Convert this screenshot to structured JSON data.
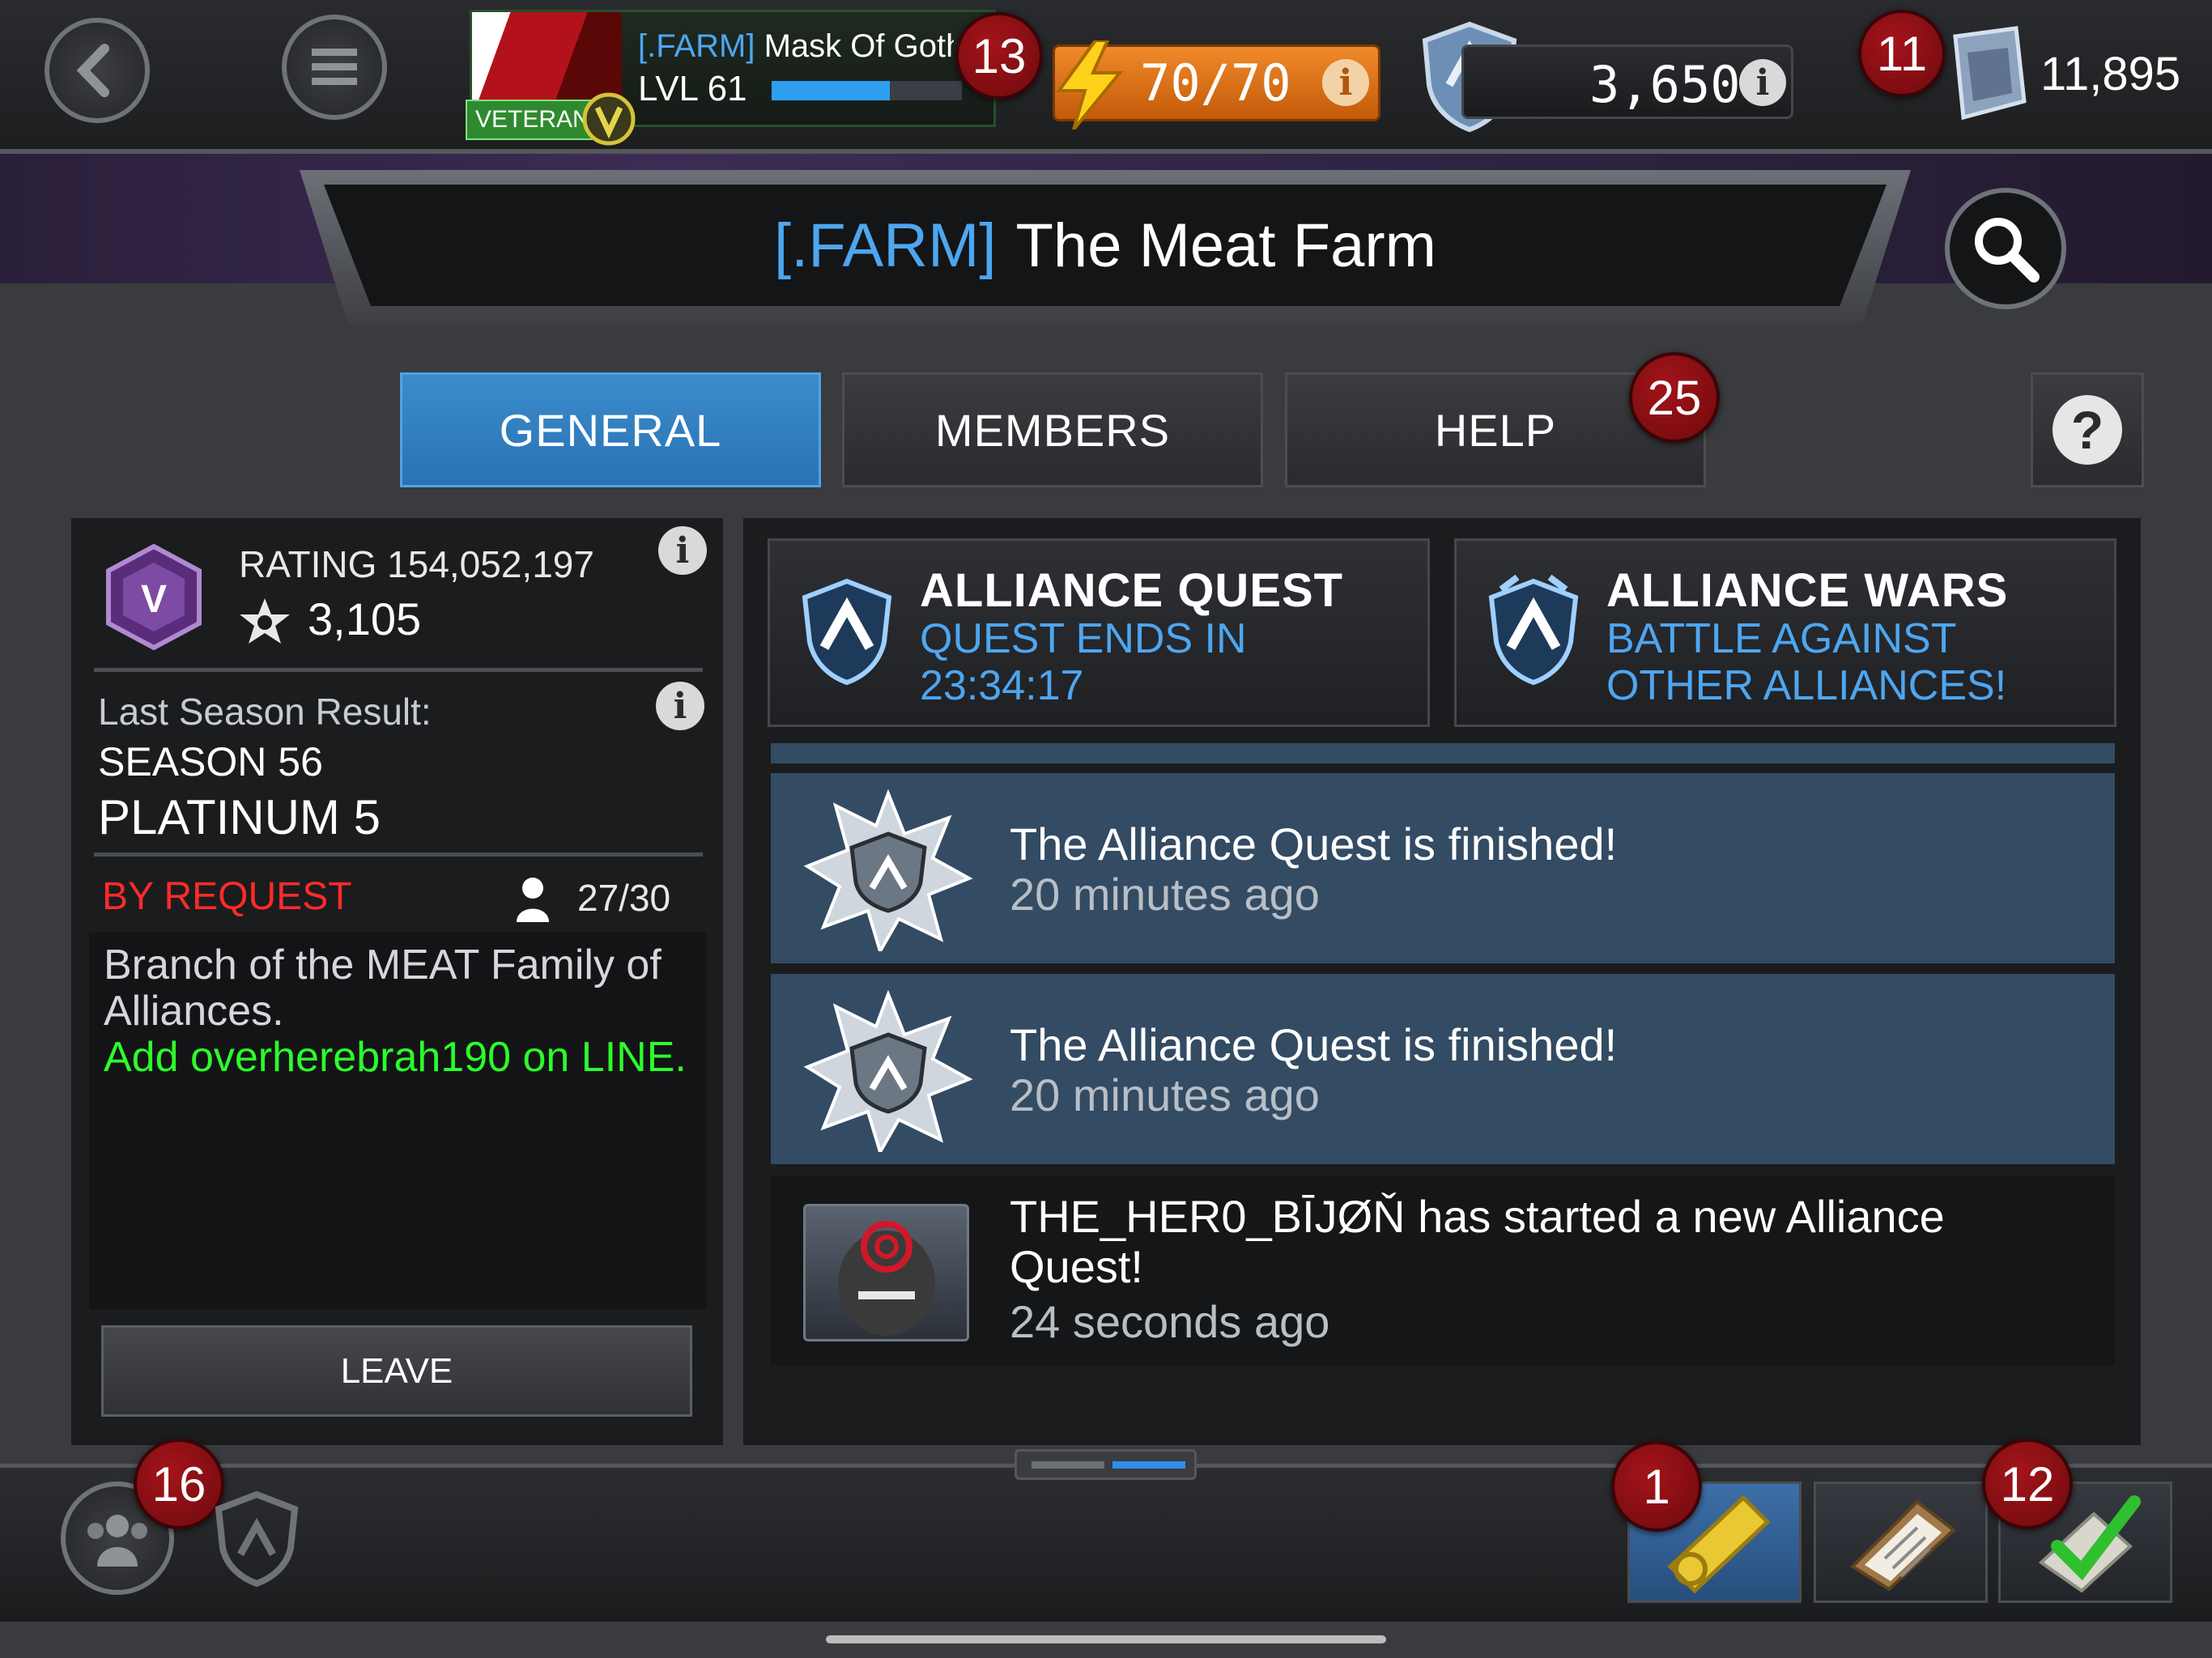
{
  "topbar": {
    "player": {
      "alliance_tag": "[.FARM]",
      "name": "Mask Of Gotha",
      "level": "LVL 61",
      "veteran": "VETERAN",
      "level_progress": 0.62
    },
    "profile_badge": "13",
    "energy": "70/70",
    "units": "3,650",
    "crystals_badge": "11",
    "crystals": "11,895"
  },
  "title": {
    "tag": "[.FARM]",
    "name": "The Meat Farm"
  },
  "tabs": [
    {
      "label": "GENERAL",
      "active": true
    },
    {
      "label": "MEMBERS",
      "active": false
    },
    {
      "label": "HELP",
      "active": false
    }
  ],
  "help_badge": "25",
  "info": {
    "rating": "RATING 154,052,197",
    "prestige": "3,105",
    "last_season_label": "Last Season Result:",
    "season": "SEASON 56",
    "tier": "PLATINUM 5",
    "join_type": "BY REQUEST",
    "members_count": "27/30",
    "description_line": "Branch of the MEAT Family of Alliances.",
    "description_note": "Add overherebrah190 on LINE.",
    "leave_label": "LEAVE"
  },
  "modes": [
    {
      "title": "ALLIANCE QUEST",
      "sub1": "QUEST ENDS IN",
      "sub2": "23:34:17"
    },
    {
      "title": "ALLIANCE WARS",
      "sub1": "BATTLE AGAINST",
      "sub2": "OTHER ALLIANCES!"
    }
  ],
  "feed": [
    {
      "text": "The Alliance Quest is finished!",
      "time": "20 minutes ago"
    },
    {
      "text": "The Alliance Quest is finished!",
      "time": "20 minutes ago"
    },
    {
      "text": "THE_HER0_BĪJØŇ has started a new Alliance Quest!",
      "time": "24 seconds ago"
    }
  ],
  "bottombar": {
    "alliance_badge": "16",
    "loot_badge": "1",
    "quests_badge": "12"
  },
  "colors": {
    "accent_blue": "#2a72b3",
    "energy_orange": "#e07b1f",
    "badge_red": "#8f1016",
    "request_red": "#ff2a2a",
    "note_green": "#2bff2b",
    "feed_blue": "#334b63"
  }
}
